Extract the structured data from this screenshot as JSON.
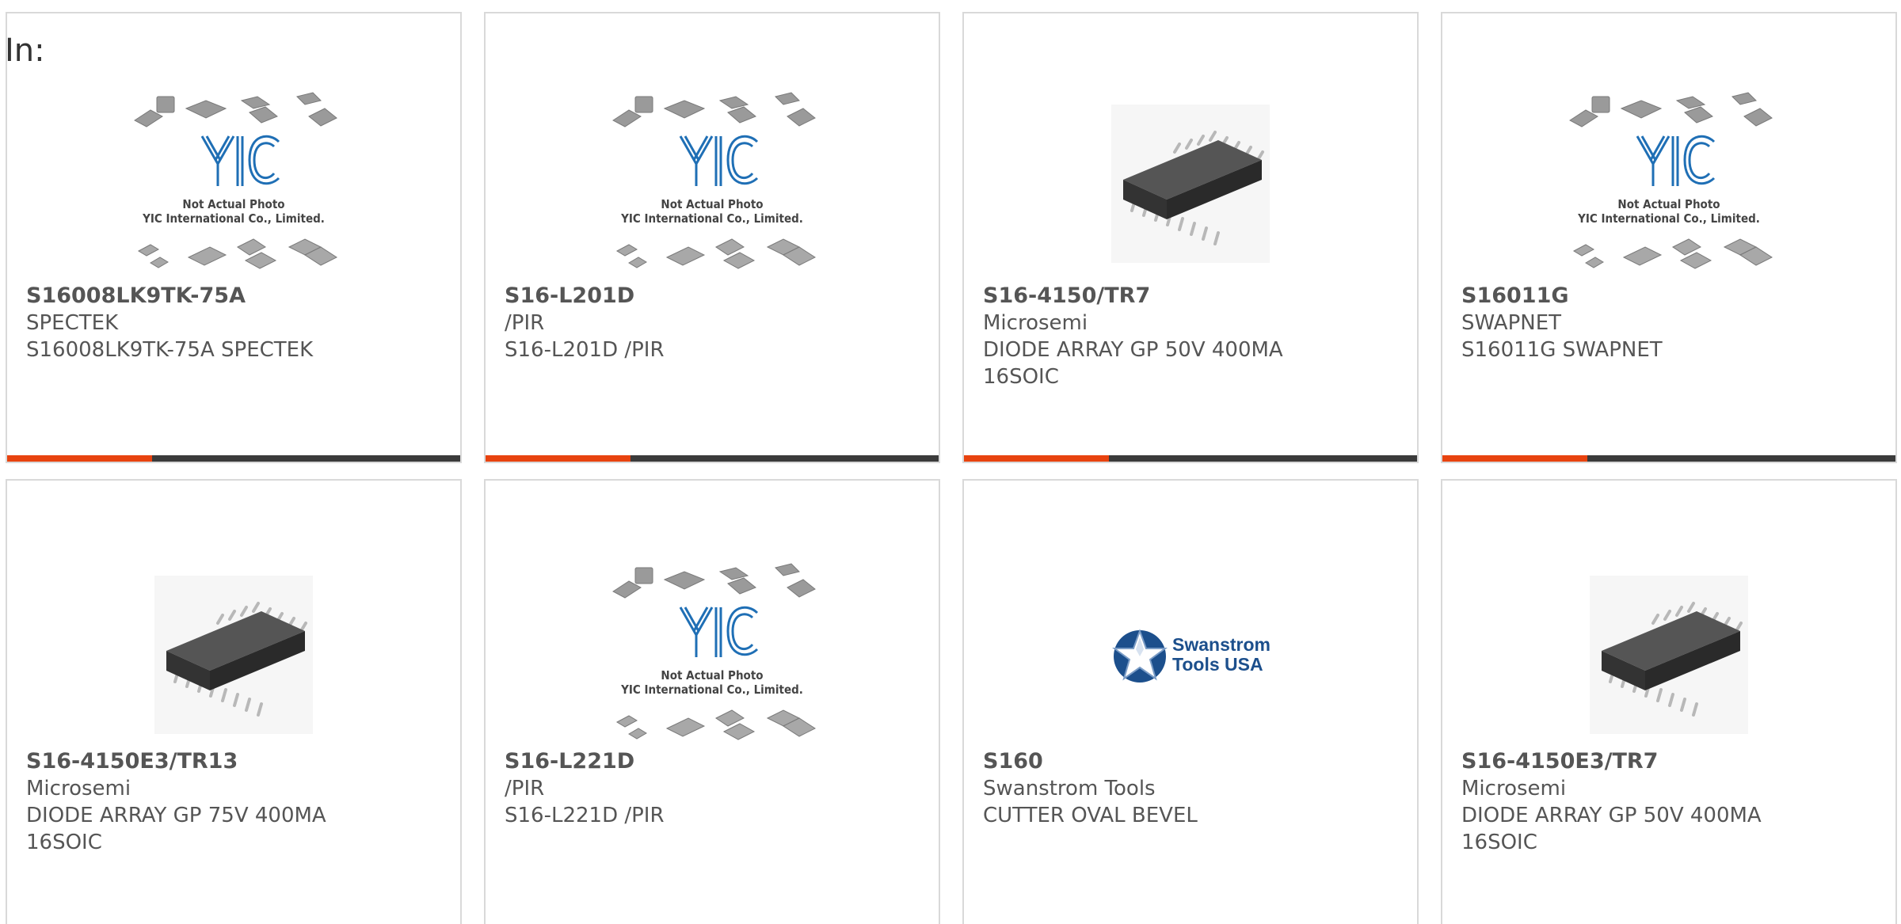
{
  "page": {
    "search_prefix": "In:"
  },
  "products": [
    {
      "part_number": "S16008LK9TK-75A",
      "manufacturer": "SPECTEK",
      "description": "S16008LK9TK-75A SPECTEK",
      "image": "yic-placeholder",
      "image_text": [
        "Not Actual Photo",
        "YIC International Co., Limited."
      ]
    },
    {
      "part_number": "S16-L201D",
      "manufacturer": "/PIR",
      "description": "S16-L201D /PIR",
      "image": "yic-placeholder",
      "image_text": [
        "Not Actual Photo",
        "YIC International Co., Limited."
      ]
    },
    {
      "part_number": "S16-4150/TR7",
      "manufacturer": "Microsemi",
      "description": "DIODE ARRAY GP 50V 400MA 16SOIC",
      "image": "soic16-chip"
    },
    {
      "part_number": "S16011G",
      "manufacturer": "SWAPNET",
      "description": "S16011G SWAPNET",
      "image": "yic-placeholder",
      "image_text": [
        "Not Actual Photo",
        "YIC International Co., Limited."
      ]
    },
    {
      "part_number": "S16-4150E3/TR13",
      "manufacturer": "Microsemi",
      "description": "DIODE ARRAY GP 75V 400MA 16SOIC",
      "image": "soic16-chip"
    },
    {
      "part_number": "S16-L221D",
      "manufacturer": "/PIR",
      "description": "S16-L221D /PIR",
      "image": "yic-placeholder",
      "image_text": [
        "Not Actual Photo",
        "YIC International Co., Limited."
      ]
    },
    {
      "part_number": "S160",
      "manufacturer": "Swanstrom Tools",
      "description": "CUTTER OVAL BEVEL",
      "image": "swanstrom-logo",
      "image_text": [
        "Swanstrom",
        "Tools USA"
      ]
    },
    {
      "part_number": "S16-4150E3/TR7",
      "manufacturer": "Microsemi",
      "description": "DIODE ARRAY GP 50V 400MA 16SOIC",
      "image": "soic16-chip"
    }
  ],
  "colors": {
    "accent": "#e8430f",
    "bar_dark": "#3b3b3b",
    "text": "#555555",
    "border": "#d9d9d9"
  }
}
